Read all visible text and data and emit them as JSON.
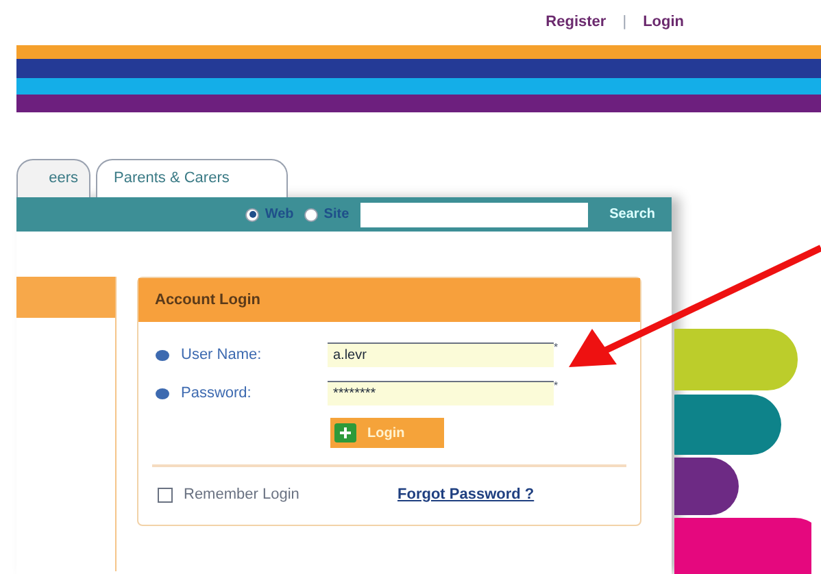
{
  "top_links": [
    "Register",
    "Login"
  ],
  "top_separator": "|",
  "tabs": [
    {
      "label": "eers",
      "selected": false
    },
    {
      "label": "Parents & Carers",
      "selected": true
    }
  ],
  "search_bar": {
    "options": [
      {
        "label": "Web",
        "selected": true
      },
      {
        "label": "Site",
        "selected": false
      }
    ],
    "button": "Search"
  },
  "login_box": {
    "title": "Account Login",
    "fields": [
      {
        "label": "User Name:",
        "value": "a.levr",
        "required": "*"
      },
      {
        "label": "Password:",
        "value": "********",
        "required": "*"
      }
    ],
    "button": "Login",
    "remember": {
      "label": "Remember Login",
      "checked": false
    },
    "forgot_link": "Forgot Password ?"
  }
}
